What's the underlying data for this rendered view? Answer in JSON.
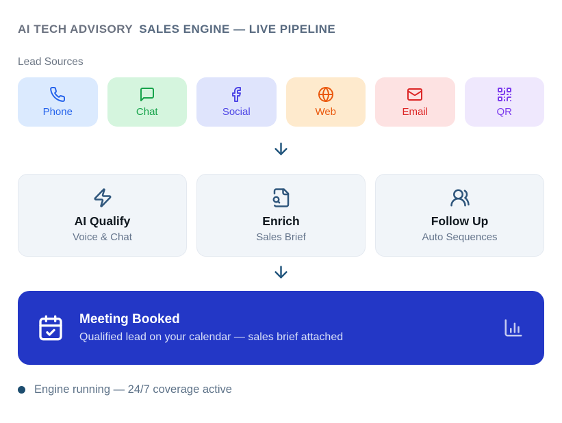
{
  "header": {
    "brand": "AI TECH ADVISORY",
    "title": "SALES ENGINE — LIVE PIPELINE"
  },
  "lead_sources": {
    "label": "Lead Sources",
    "items": [
      {
        "label": "Phone",
        "icon": "phone-icon",
        "bg": "#dbeafe",
        "color": "#2563eb"
      },
      {
        "label": "Chat",
        "icon": "chat-icon",
        "bg": "#d5f5de",
        "color": "#16a34a"
      },
      {
        "label": "Social",
        "icon": "facebook-icon",
        "bg": "#dfe4fc",
        "color": "#4f46e5"
      },
      {
        "label": "Web",
        "icon": "globe-icon",
        "bg": "#feeacd",
        "color": "#ea580c"
      },
      {
        "label": "Email",
        "icon": "mail-icon",
        "bg": "#fde2e2",
        "color": "#dc2626"
      },
      {
        "label": "QR",
        "icon": "qr-code-icon",
        "bg": "#efe8fd",
        "color": "#7c3aed"
      }
    ]
  },
  "pipeline": {
    "stages": [
      {
        "title": "AI Qualify",
        "subtitle": "Voice & Chat",
        "icon": "zap-icon"
      },
      {
        "title": "Enrich",
        "subtitle": "Sales Brief",
        "icon": "file-search-icon"
      },
      {
        "title": "Follow Up",
        "subtitle": "Auto Sequences",
        "icon": "users-icon"
      }
    ]
  },
  "banner": {
    "title": "Meeting Booked",
    "subtitle": "Qualified lead on your calendar — sales brief attached",
    "icon": "calendar-check-icon",
    "chart_icon": "bar-chart-icon",
    "bg": "#2337c6"
  },
  "status": {
    "text": "Engine running — 24/7 coverage active",
    "dot_color": "#1d4d6f"
  },
  "colors": {
    "arrow": "#23567d"
  }
}
